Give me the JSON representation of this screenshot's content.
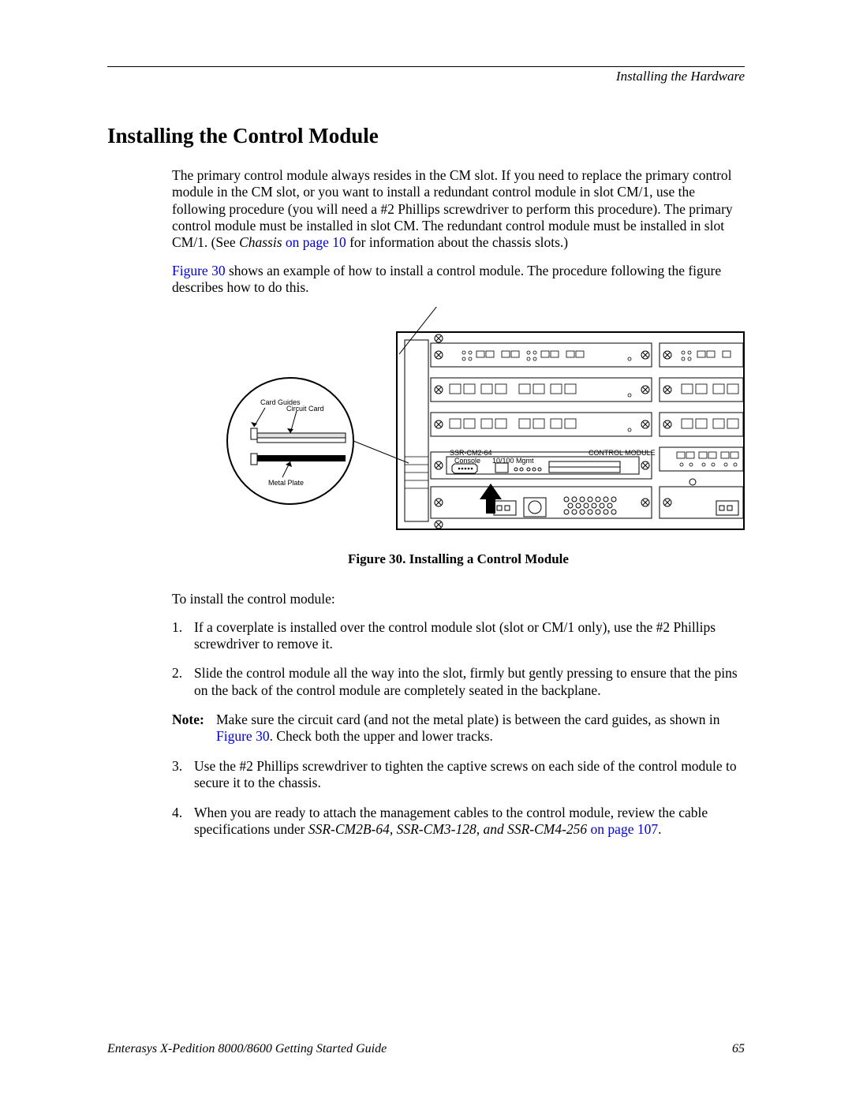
{
  "running_head": "Installing the Hardware",
  "section_title": "Installing the Control Module",
  "intro_para_full": "The primary control module always resides in the CM slot. If you need to replace the primary control module in the CM slot, or you want to install a redundant control module in slot CM/1, use the following procedure (you will need a #2 Phillips screwdriver to perform this procedure). The primary control module must be installed in slot CM. The redundant control module must be installed in slot CM/1. (See ",
  "intro_chassis_ital": "Chassis",
  "intro_xref1": " on page 10",
  "intro_tail": " for information about the chassis slots.)",
  "lead_xref": "Figure 30",
  "lead_tail": " shows an example of how to install a control module. The procedure following the figure describes how to do this.",
  "figure": {
    "card_guides": "Card Guides",
    "circuit_card": "Circuit Card",
    "metal_plate": "Metal Plate",
    "module_label_left": "SSR-CM2-64",
    "module_label_right": "CONTROL MODULE",
    "console": "Console",
    "mgmt": "10/100 Mgmt",
    "caption": "Figure 30.  Installing a Control Module"
  },
  "intro_list": "To install the control module:",
  "steps": {
    "s1": "If a coverplate is installed over the control module slot (slot or CM/1 only), use the #2 Phillips screwdriver to remove it.",
    "s2": "Slide the control module all the way into the slot, firmly but gently pressing to ensure that the pins on the back of the control module are completely seated in the backplane.",
    "s3": "Use the #2 Phillips screwdriver to tighten the captive screws on each side of the control module to secure it to the chassis.",
    "s4_pre": "When you are ready to attach the management cables to the control module, review the cable specifications under ",
    "s4_ital": "SSR-CM2B-64, SSR-CM3-128, and SSR-CM4-256",
    "s4_xref": " on page 107",
    "s4_post": "."
  },
  "note": {
    "label": "Note:",
    "pre": "Make sure the circuit card (and not the metal plate) is between the card guides, as shown in ",
    "xref": "Figure 30",
    "post": ". Check both the upper and lower tracks."
  },
  "footer_left": "Enterasys X-Pedition 8000/8600 Getting Started Guide",
  "footer_page": "65",
  "nums": {
    "n1": "1.",
    "n2": "2.",
    "n3": "3.",
    "n4": "4."
  }
}
